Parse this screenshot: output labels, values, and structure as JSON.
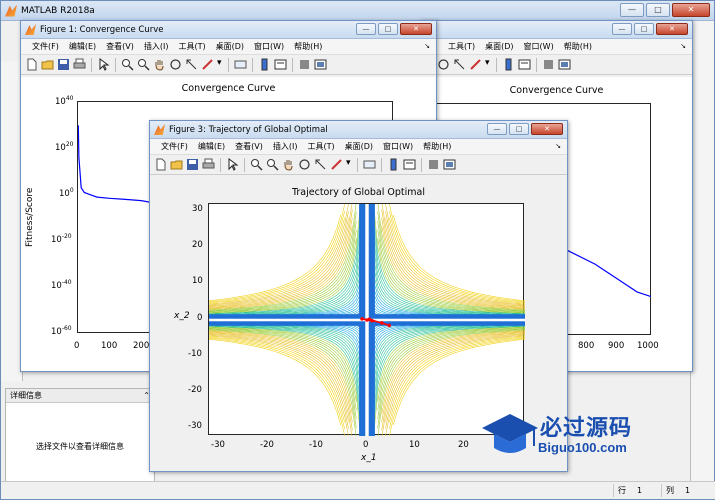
{
  "main_window": {
    "title": "MATLAB R2018a",
    "controls": {
      "minimize": "—",
      "maximize": "□",
      "close": "✕"
    }
  },
  "details_panel": {
    "header": "详细信息",
    "body": "选择文件以查看详细信息"
  },
  "statusbar": {
    "row_label": "行",
    "row_value": "1",
    "col_label": "列",
    "col_value": "1"
  },
  "menus": [
    "文件(F)",
    "编辑(E)",
    "查看(V)",
    "插入(I)",
    "工具(T)",
    "桌面(D)",
    "窗口(W)",
    "帮助(H)"
  ],
  "figure1": {
    "title": "Figure 1: Convergence Curve",
    "chart_data": {
      "type": "line",
      "title": "Convergence Curve",
      "ylabel": "Fitness/Score",
      "xlabel": "",
      "y_scale": "log",
      "ylim": [
        "1e-60",
        "1e40"
      ],
      "xlim": [
        0,
        1000
      ],
      "x_tick_labels_visible": [
        "0",
        "100",
        "200",
        "800",
        "900",
        "1000"
      ],
      "y_tick_labels": [
        "10^40",
        "10^20",
        "10^0",
        "10^-20",
        "10^-40",
        "10^-60"
      ],
      "series": [
        {
          "color": "#0000ff",
          "x": [
            1,
            3,
            10,
            20,
            40,
            60,
            100,
            150,
            200,
            300,
            400,
            500,
            600,
            700,
            800,
            850,
            900,
            950,
            1000
          ],
          "y_log10": [
            30,
            16,
            3,
            1,
            0,
            -1,
            -1.5,
            -2,
            -2.5,
            -5,
            -8,
            -12,
            -17,
            -23,
            -29,
            -33,
            -37,
            -41,
            -43
          ]
        }
      ]
    }
  },
  "figure2_right": {
    "menu_visible": [
      "工具(T)",
      "桌面(D)",
      "窗口(W)",
      "帮助(H)"
    ],
    "chart_title": "Convergence Curve",
    "x_tick_labels_visible": [
      "800",
      "900",
      "1000"
    ]
  },
  "figure3": {
    "title": "Figure 3: Trajectory of Global Optimal",
    "chart_data": {
      "type": "contour",
      "title": "Trajectory of Global Optimal",
      "xlabel": "x_1",
      "ylabel": "x_2",
      "xlim": [
        -32,
        32
      ],
      "ylim": [
        -32,
        32
      ],
      "x_tick_labels": [
        "-30",
        "-20",
        "-10",
        "0",
        "10",
        "20"
      ],
      "y_tick_labels": [
        "30",
        "20",
        "10",
        "0",
        "-10",
        "-20",
        "-30"
      ],
      "colormap": [
        "#2b3bd1",
        "#1aa7e0",
        "#2cc19a",
        "#9fcc3b",
        "#e8c22c",
        "#f2d21a"
      ],
      "trajectory_color": "#ff0000",
      "trajectory_points": [
        [
          0,
          0
        ],
        [
          -1,
          0.3
        ],
        [
          1,
          -0.2
        ],
        [
          3,
          -0.8
        ],
        [
          4.5,
          -1.5
        ],
        [
          0.5,
          0.2
        ]
      ]
    }
  },
  "watermark": {
    "brand_cn": "必过源码",
    "url": "Biguo100.com"
  }
}
